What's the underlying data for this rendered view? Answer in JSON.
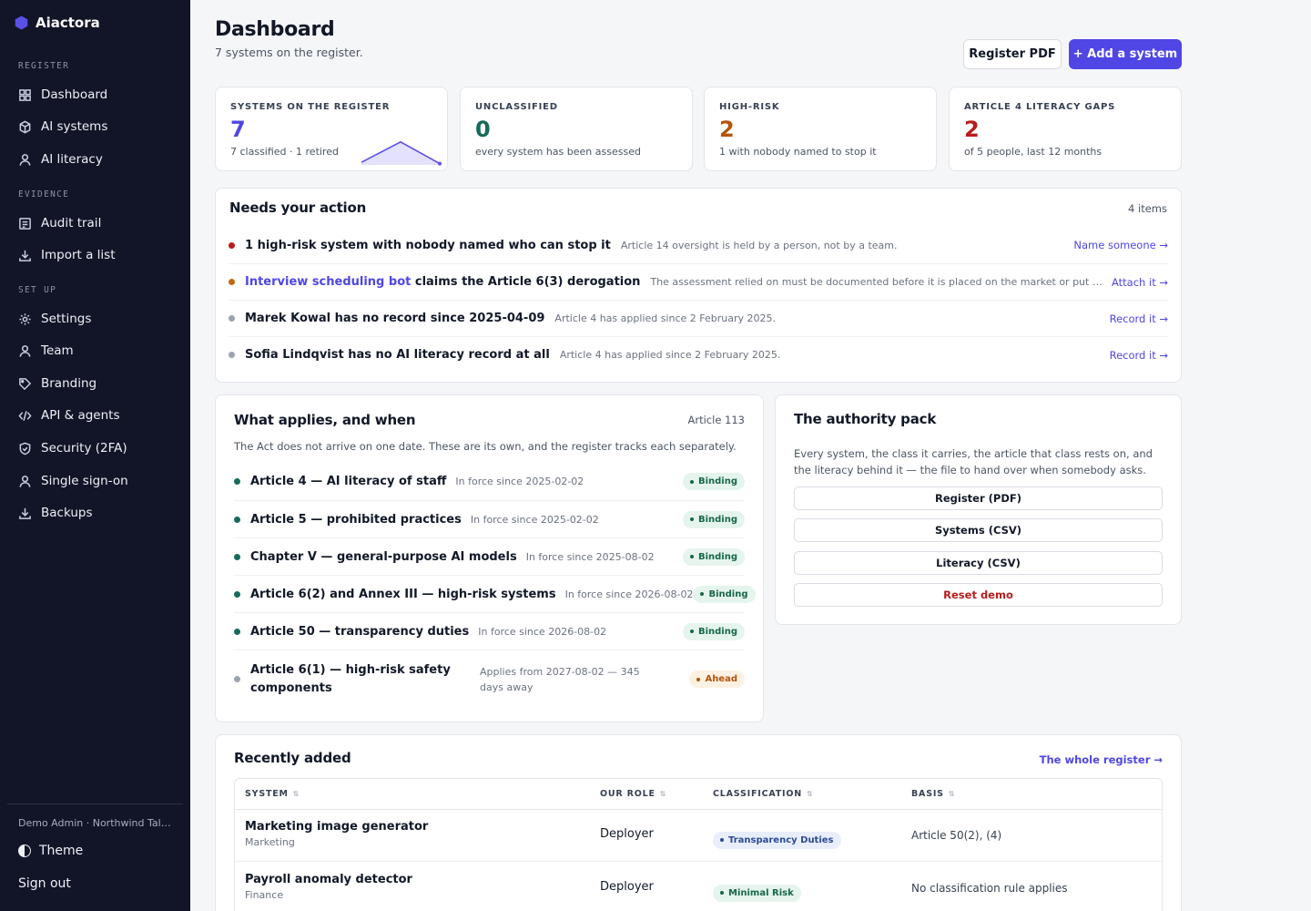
{
  "app": {
    "name": "Aiactora"
  },
  "sidebar": {
    "sections": [
      {
        "label": "REGISTER"
      },
      {
        "label": "EVIDENCE"
      },
      {
        "label": "SET UP"
      }
    ],
    "items": [
      {
        "label": "Dashboard",
        "icon": "dashboard-icon"
      },
      {
        "label": "AI systems",
        "icon": "cube-icon"
      },
      {
        "label": "AI literacy",
        "icon": "person-icon"
      },
      {
        "label": "Audit trail",
        "icon": "list-icon"
      },
      {
        "label": "Import a list",
        "icon": "download-icon"
      },
      {
        "label": "Settings",
        "icon": "gear-icon"
      },
      {
        "label": "Team",
        "icon": "person-icon"
      },
      {
        "label": "Branding",
        "icon": "tag-icon"
      },
      {
        "label": "API & agents",
        "icon": "code-icon"
      },
      {
        "label": "Security (2FA)",
        "icon": "shield-icon"
      },
      {
        "label": "Single sign-on",
        "icon": "person-icon"
      },
      {
        "label": "Backups",
        "icon": "download-icon"
      }
    ],
    "user": "Demo Admin · Northwind Talent",
    "theme_label": "Theme",
    "signout_label": "Sign out"
  },
  "header": {
    "title": "Dashboard",
    "subtitle": "7 systems on the register.",
    "register_pdf_label": "Register PDF",
    "add_system_label": "+ Add a system"
  },
  "stats": [
    {
      "label": "SYSTEMS ON THE REGISTER",
      "value": "7",
      "note": "7 classified · 1 retired",
      "color": "#4f46e5"
    },
    {
      "label": "UNCLASSIFIED",
      "value": "0",
      "note": "every system has been assessed",
      "color": "#166b5a"
    },
    {
      "label": "HIGH-RISK",
      "value": "2",
      "note": "1 with nobody named to stop it",
      "color": "#b45309"
    },
    {
      "label": "ARTICLE 4 LITERACY GAPS",
      "value": "2",
      "note": "of 5 people, last 12 months",
      "color": "#b91c1c"
    }
  ],
  "actions": {
    "title": "Needs your action",
    "count": "4 items",
    "items": [
      {
        "prefix": "",
        "link": "",
        "head": "1 high-risk system with nobody named who can stop it",
        "desc": "Article 14 oversight is held by a person, not by a team.",
        "cta": "Name someone →",
        "dot": "#b91c1c"
      },
      {
        "prefix": "",
        "link": "Interview scheduling bot",
        "head": " claims the Article 6(3) derogation",
        "desc": "The assessment relied on must be documented before it is placed on the market or put into service.",
        "cta": "Attach it →",
        "dot": "#c2690f"
      },
      {
        "prefix": "",
        "link": "",
        "head": "Marek Kowal has no record since 2025-04-09",
        "desc": "Article 4 has applied since 2 February 2025.",
        "cta": "Record it →",
        "dot": "#9ca3af"
      },
      {
        "prefix": "",
        "link": "",
        "head": "Sofia Lindqvist has no AI literacy record at all",
        "desc": "Article 4 has applied since 2 February 2025.",
        "cta": "Record it →",
        "dot": "#9ca3af"
      }
    ]
  },
  "applies": {
    "title": "What applies, and when",
    "meta": "Article 113",
    "desc": "The Act does not arrive on one date. These are its own, and the register tracks each separately.",
    "items": [
      {
        "title": "Article 4 — AI literacy of staff",
        "date": "In force since 2025-02-02",
        "badge": "Binding",
        "status": "binding"
      },
      {
        "title": "Article 5 — prohibited practices",
        "date": "In force since 2025-02-02",
        "badge": "Binding",
        "status": "binding"
      },
      {
        "title": "Chapter V — general-purpose AI models",
        "date": "In force since 2025-08-02",
        "badge": "Binding",
        "status": "binding"
      },
      {
        "title": "Article 6(2) and Annex III — high-risk systems",
        "date": "In force since 2026-08-02",
        "badge": "Binding",
        "status": "binding"
      },
      {
        "title": "Article 50 — transparency duties",
        "date": "In force since 2026-08-02",
        "badge": "Binding",
        "status": "binding"
      },
      {
        "title": "Article 6(1) — high-risk safety components",
        "date": "Applies from 2027-08-02 — 345 days away",
        "badge": "Ahead",
        "status": "ahead"
      }
    ]
  },
  "authority": {
    "title": "The authority pack",
    "desc": "Every system, the class it carries, the article that class rests on, and the literacy behind it — the file to hand over when somebody asks.",
    "buttons": [
      "Register (PDF)",
      "Systems (CSV)",
      "Literacy (CSV)",
      "Reset demo"
    ]
  },
  "recent": {
    "title": "Recently added",
    "link": "The whole register →",
    "columns": [
      "SYSTEM",
      "OUR ROLE",
      "CLASSIFICATION",
      "BASIS"
    ],
    "rows": [
      {
        "name": "Marketing image generator",
        "dept": "Marketing",
        "role": "Deployer",
        "classification": "Transparency Duties",
        "cls": "transparency",
        "basis": "Article 50(2), (4)"
      },
      {
        "name": "Payroll anomaly detector",
        "dept": "Finance",
        "role": "Deployer",
        "classification": "Minimal Risk",
        "cls": "minimal",
        "basis": "No classification rule applies"
      }
    ]
  },
  "sparkline": {
    "values": [
      0.1,
      0.9,
      0.05
    ]
  },
  "colors": {
    "accent": "#4f46e5",
    "sidebar": "#121528",
    "binding": "#166848",
    "ahead": "#b45309"
  }
}
